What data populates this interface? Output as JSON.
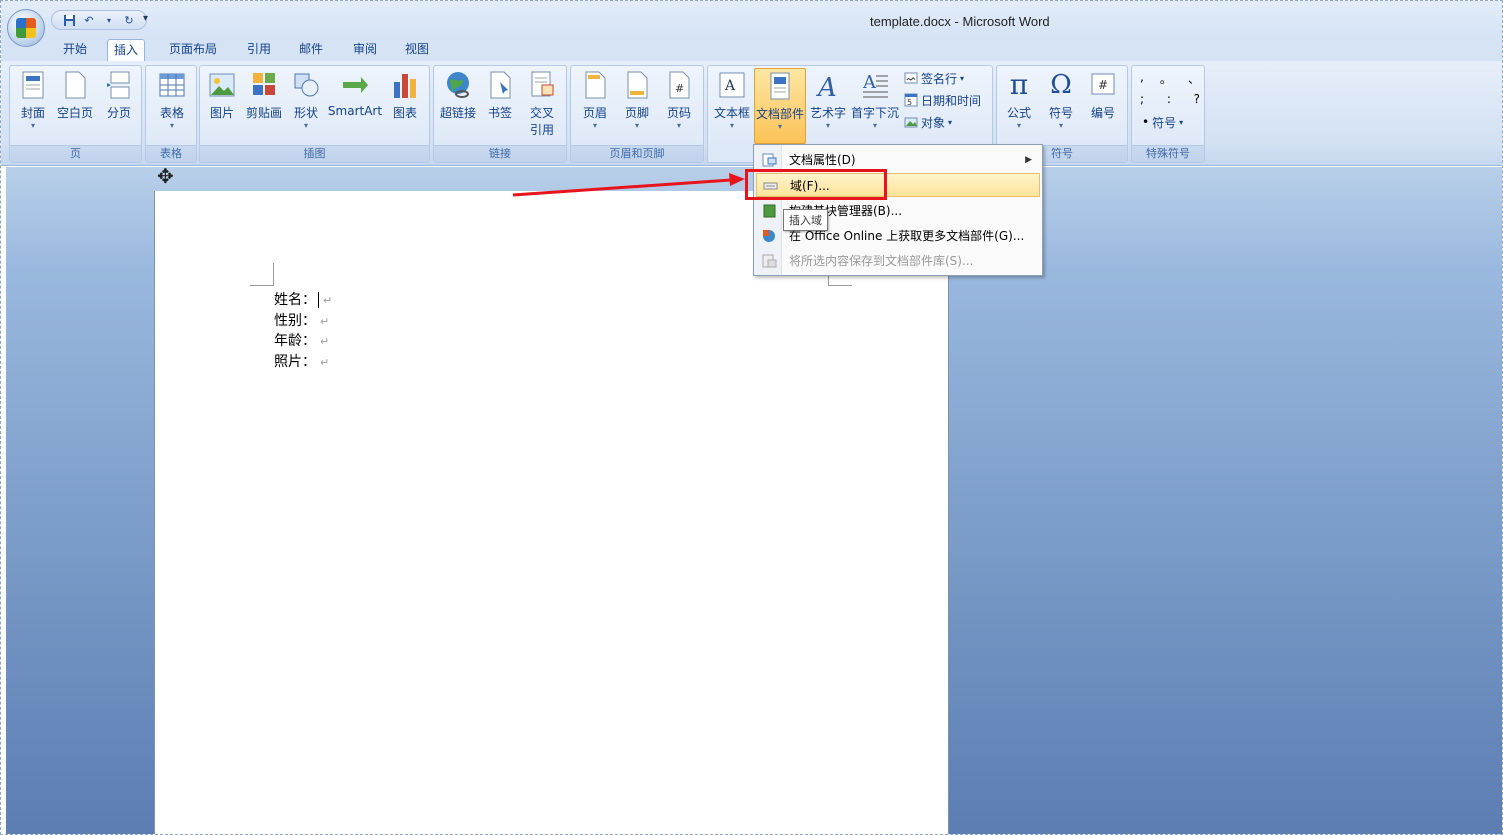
{
  "window": {
    "title": "template.docx - Microsoft Word"
  },
  "qat": {
    "save_icon": "save-icon",
    "undo_icon": "undo-icon",
    "redo_icon": "redo-icon",
    "more": "▾"
  },
  "tabs": [
    {
      "label": "开始",
      "active": false
    },
    {
      "label": "插入",
      "active": true
    },
    {
      "label": "页面布局",
      "active": false
    },
    {
      "label": "引用",
      "active": false
    },
    {
      "label": "邮件",
      "active": false
    },
    {
      "label": "审阅",
      "active": false
    },
    {
      "label": "视图",
      "active": false
    }
  ],
  "ribbon": {
    "pages": {
      "label": "页",
      "cover": "封面",
      "blank": "空白页",
      "break": "分页"
    },
    "tables": {
      "label": "表格",
      "table": "表格"
    },
    "illustrations": {
      "label": "插图",
      "picture": "图片",
      "clipart": "剪贴画",
      "shapes": "形状",
      "smartart": "SmartArt",
      "chart": "图表"
    },
    "links": {
      "label": "链接",
      "hyperlink": "超链接",
      "bookmark": "书签",
      "crossref_1": "交叉",
      "crossref_2": "引用"
    },
    "header_footer": {
      "label": "页眉和页脚",
      "header": "页眉",
      "footer": "页脚",
      "page_number": "页码"
    },
    "text": {
      "textbox": "文本框",
      "quickparts": "文档部件",
      "wordart": "艺术字",
      "dropcap": "首字下沉",
      "signature": "签名行",
      "datetime": "日期和时间",
      "object": "对象"
    },
    "symbols": {
      "label": "符号",
      "equation": "公式",
      "symbol": "符号",
      "number": "编号"
    },
    "special": {
      "label": "特殊符号",
      "row1": [
        ",",
        "。",
        "、"
      ],
      "row2": [
        ";",
        ":",
        "?"
      ],
      "symbol": "符号"
    }
  },
  "menu": {
    "items": [
      {
        "label": "文档属性(D)",
        "submenu": "▶"
      },
      {
        "label": "域(F)..."
      },
      {
        "label": "构建基块管理器(B)..."
      },
      {
        "label": "在 Office Online 上获取更多文档部件(G)..."
      },
      {
        "label": "将所选内容保存到文档部件库(S)..."
      }
    ],
    "tooltip": "插入域"
  },
  "document": {
    "lines": [
      "姓名：",
      "性别：",
      "年龄：",
      "照片："
    ],
    "para_mark": "↵"
  },
  "colors": {
    "annotation": "#e8141c",
    "ribbon": "#dbe7f6",
    "workspace": "#7898c6"
  }
}
